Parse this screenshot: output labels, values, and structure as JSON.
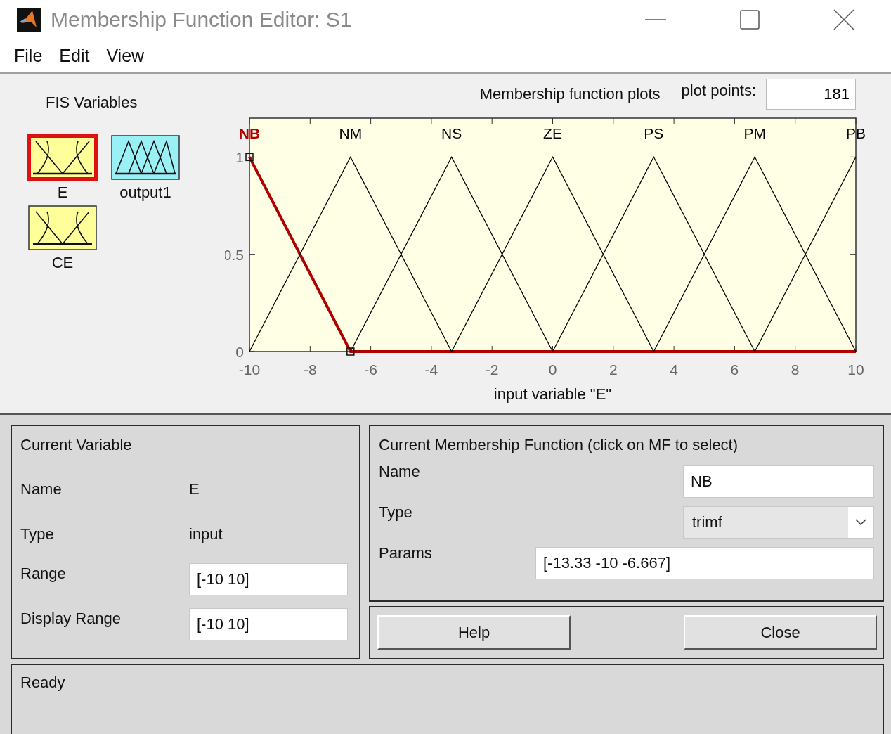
{
  "window": {
    "title": "Membership Function Editor: S1"
  },
  "menu": [
    "File",
    "Edit",
    "View"
  ],
  "fis_variables": {
    "title": "FIS Variables",
    "items": [
      {
        "label": "E",
        "kind": "input",
        "selected": true
      },
      {
        "label": "output1",
        "kind": "output",
        "selected": false
      },
      {
        "label": "CE",
        "kind": "input",
        "selected": false
      }
    ]
  },
  "plot": {
    "title": "Membership function plots",
    "plot_points": {
      "label": "plot points:",
      "value": "181"
    },
    "chart_data": {
      "type": "line",
      "xlabel": "input variable \"E\"",
      "x": [
        -10,
        -6.667,
        -3.333,
        0,
        3.333,
        6.667,
        10
      ],
      "xlim": [
        -10,
        10
      ],
      "ylim": [
        0,
        1.2
      ],
      "xticks": [
        -10,
        -8,
        -6,
        -4,
        -2,
        0,
        2,
        4,
        6,
        8,
        10
      ],
      "yticks": [
        0,
        0.5,
        1
      ],
      "series": [
        {
          "name": "NB",
          "color": "#b00000",
          "values": [
            1,
            0,
            0,
            0,
            0,
            0,
            0
          ]
        },
        {
          "name": "NM",
          "color": "#000000",
          "values": [
            0,
            1,
            0,
            null,
            null,
            null,
            null
          ]
        },
        {
          "name": "NS",
          "color": "#000000",
          "values": [
            null,
            0,
            1,
            0,
            null,
            null,
            null
          ]
        },
        {
          "name": "ZE",
          "color": "#000000",
          "values": [
            null,
            null,
            0,
            1,
            0,
            null,
            null
          ]
        },
        {
          "name": "PS",
          "color": "#000000",
          "values": [
            null,
            null,
            null,
            0,
            1,
            0,
            null
          ]
        },
        {
          "name": "PM",
          "color": "#000000",
          "values": [
            null,
            null,
            null,
            null,
            0,
            1,
            0
          ]
        },
        {
          "name": "PB",
          "color": "#000000",
          "values": [
            null,
            null,
            null,
            null,
            null,
            0,
            1
          ]
        }
      ]
    }
  },
  "current_variable": {
    "title": "Current Variable",
    "fields": [
      {
        "label": "Name",
        "value": "E",
        "kind": "text"
      },
      {
        "label": "Type",
        "value": "input",
        "kind": "text"
      },
      {
        "label": "Range",
        "value": "[-10 10]",
        "kind": "field"
      },
      {
        "label": "Display Range",
        "value": "[-10 10]",
        "kind": "field"
      }
    ]
  },
  "current_mf": {
    "title": "Current Membership Function (click on MF to select)",
    "fields": [
      {
        "label": "Name",
        "value": "NB",
        "kind": "field"
      },
      {
        "label": "Type",
        "value": "trimf",
        "kind": "dropdown"
      },
      {
        "label": "Params",
        "value": "[-13.33 -10 -6.667]",
        "kind": "wide"
      }
    ]
  },
  "buttons": [
    "Help",
    "Close"
  ],
  "status_bar": "Ready"
}
